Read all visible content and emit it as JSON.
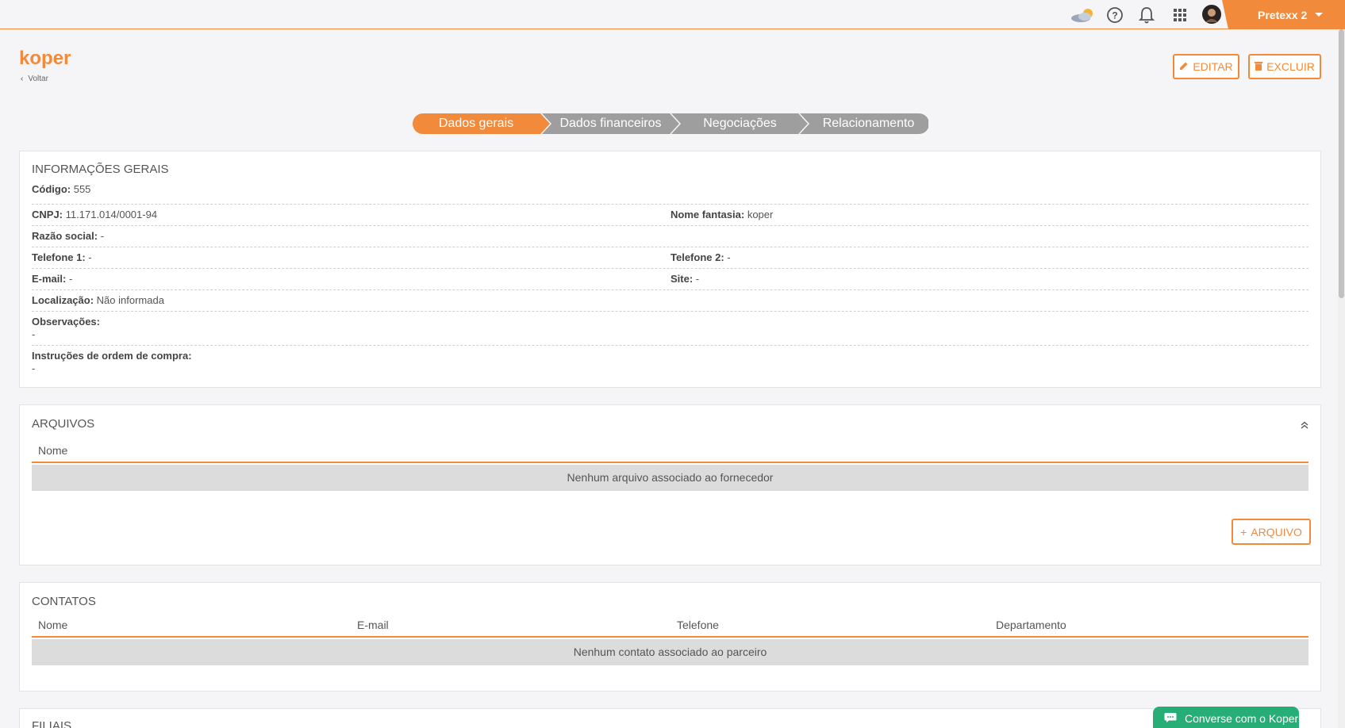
{
  "topbar": {
    "icons": [
      "weather-icon",
      "help-icon",
      "bell-icon",
      "apps-grid-icon",
      "avatar"
    ],
    "user_label": "Pretexx 2"
  },
  "header": {
    "title": "koper",
    "back_label": "Voltar",
    "edit_label": "EDITAR",
    "delete_label": "EXCLUIR"
  },
  "steps": [
    "Dados gerais",
    "Dados financeiros",
    "Negociações",
    "Relacionamento"
  ],
  "info": {
    "title": "INFORMAÇÕES GERAIS",
    "codigo_label": "Código:",
    "codigo_value": "555",
    "cnpj_label": "CNPJ:",
    "cnpj_value": "11.171.014/0001-94",
    "fantasia_label": "Nome fantasia:",
    "fantasia_value": "koper",
    "razao_label": "Razão social:",
    "razao_value": "-",
    "tel1_label": "Telefone 1:",
    "tel1_value": "-",
    "tel2_label": "Telefone 2:",
    "tel2_value": "-",
    "email_label": "E-mail:",
    "email_value": "-",
    "site_label": "Site:",
    "site_value": "-",
    "local_label": "Localização:",
    "local_value": "Não informada",
    "obs_label": "Observações:",
    "obs_value": "-",
    "instr_label": "Instruções de ordem de compra:",
    "instr_value": "-"
  },
  "arquivos": {
    "title": "ARQUIVOS",
    "col_nome": "Nome",
    "empty": "Nenhum arquivo associado ao fornecedor",
    "add_label": "ARQUIVO"
  },
  "contatos": {
    "title": "CONTATOS",
    "columns": [
      "Nome",
      "E-mail",
      "Telefone",
      "Departamento"
    ],
    "empty": "Nenhum contato associado ao parceiro"
  },
  "filiais": {
    "title": "FILIAIS"
  },
  "chat": {
    "label": "Converse com o Koper"
  },
  "colors": {
    "accent": "#f28a3c",
    "step_inactive": "#9e9e9e",
    "chat": "#27ae77"
  }
}
